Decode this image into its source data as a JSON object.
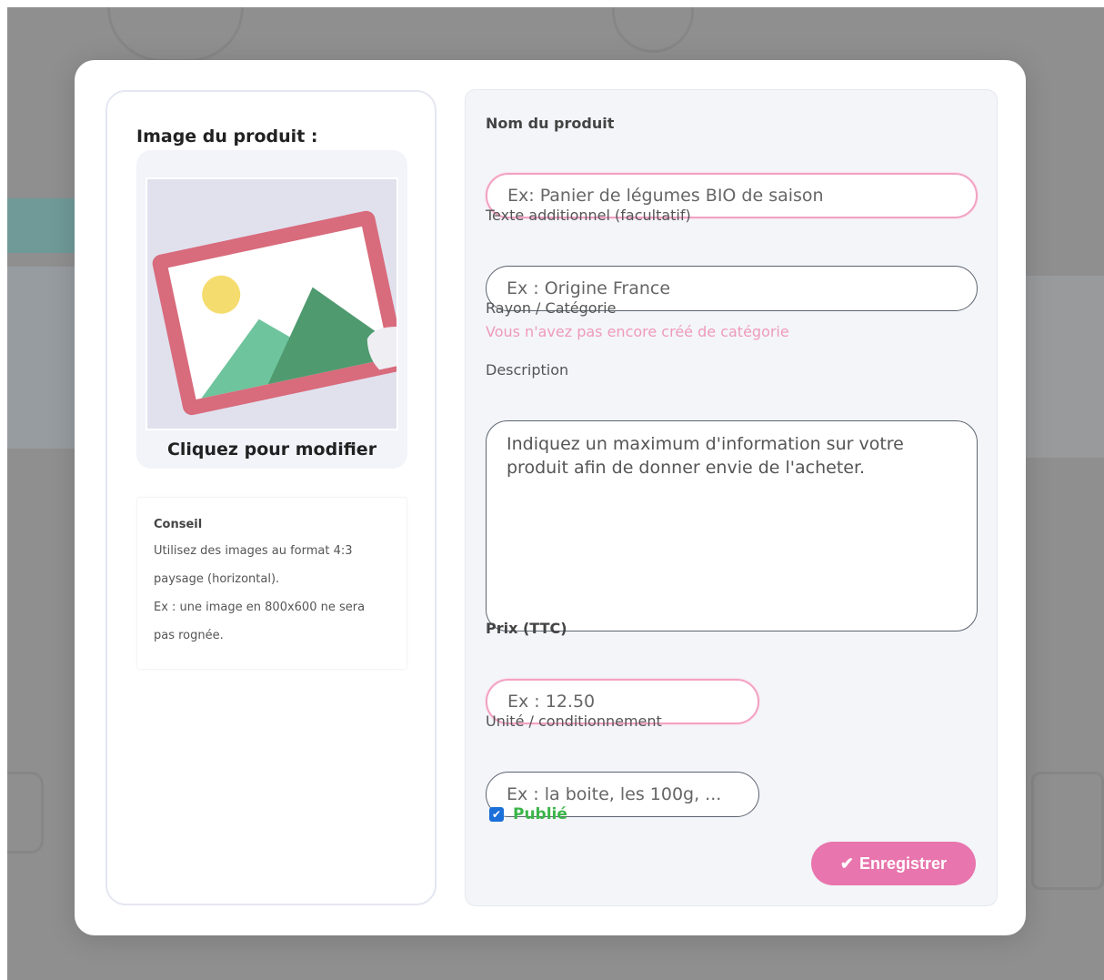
{
  "image_panel": {
    "title": "Image du produit :",
    "caption": "Cliquez pour modifier",
    "placeholder_icon": "image-placeholder-icon"
  },
  "tip": {
    "title": "Conseil",
    "lines": [
      "Utilisez des images au format 4:3",
      "paysage (horizontal).",
      "Ex : une image en 800x600 ne sera",
      "pas rognée."
    ]
  },
  "form": {
    "name": {
      "label": "Nom du produit",
      "placeholder": "Ex: Panier de légumes BIO de saison"
    },
    "extra_text": {
      "label": "Texte additionnel (facultatif)",
      "placeholder": "Ex : Origine France"
    },
    "category": {
      "label": "Rayon / Catégorie",
      "hint": "Vous n'avez pas encore créé de catégorie"
    },
    "description": {
      "label": "Description",
      "placeholder": "Indiquez un maximum d'information sur votre produit afin de donner envie de l'acheter."
    },
    "price": {
      "label": "Prix (TTC)",
      "placeholder": "Ex : 12.50"
    },
    "unit": {
      "label": "Unité / conditionnement",
      "placeholder": "Ex : la boite, les 100g, ..."
    },
    "published": {
      "label": "Publié",
      "checked": true
    },
    "save": {
      "label": "Enregistrer",
      "icon": "checkmark-icon"
    }
  },
  "colors": {
    "accent_pink": "#e875ad",
    "hint_pink": "#ef9abb",
    "published_green": "#3bb54a",
    "checkbox_blue": "#1a6fd8",
    "overlay_gray": "#8f8f8f"
  }
}
